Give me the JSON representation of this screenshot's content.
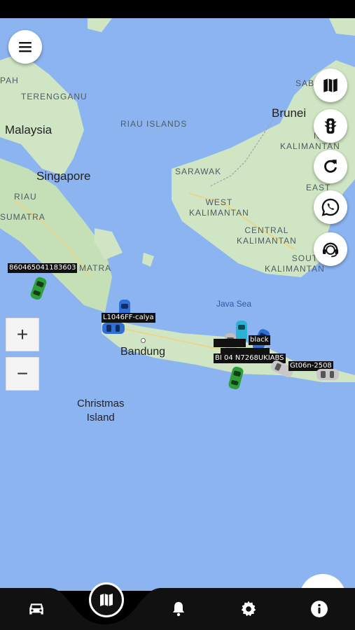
{
  "map": {
    "labels": {
      "pah": "PAH",
      "terengganu": "TERENGGANU",
      "malaysia": "Malaysia",
      "riau_islands": "RIAU ISLANDS",
      "singapore": "Singapore",
      "riau": "RIAU",
      "sumatra_1": "SUMATRA",
      "matra": "MATRA",
      "brunei": "Brunei",
      "sabah": "SAB",
      "north_kalimantan": "NORT\nKALIMANTAN",
      "sarawak": "SARAWAK",
      "west_kalimantan": "WEST\nKALIMANTAN",
      "east": "EAST",
      "central_kalimantan": "CENTRAL\nKALIMANTAN",
      "south_kalimantan": "SOUTH\nKALIMANTAN",
      "java_sea": "Java Sea",
      "bandung": "Bandung",
      "christmas_island": "Christmas\nIsland"
    },
    "vehicles": [
      {
        "label": "860465041183603",
        "color": "green"
      },
      {
        "label": "L1046FF-calya",
        "color": "blue"
      },
      {
        "label": "black",
        "color": "blue"
      },
      {
        "label": "BI 04 N7268UKIABS",
        "color": "green"
      },
      {
        "label": "Gt06n-2508",
        "color": "gray"
      }
    ],
    "zoom_in": "+",
    "zoom_out": "−"
  },
  "right_buttons": [
    "map-icon",
    "traffic-light-icon",
    "refresh-icon",
    "whatsapp-icon",
    "support-agent-icon"
  ],
  "bottom_nav": [
    "car-icon",
    "map-icon",
    "bell-icon",
    "gear-icon",
    "info-icon"
  ],
  "colors": {
    "sea": "#8cb4f0",
    "land": "#cfe5c3",
    "nav": "#111111",
    "car_green": "#2e9e3a",
    "car_blue": "#2f6fd6"
  }
}
